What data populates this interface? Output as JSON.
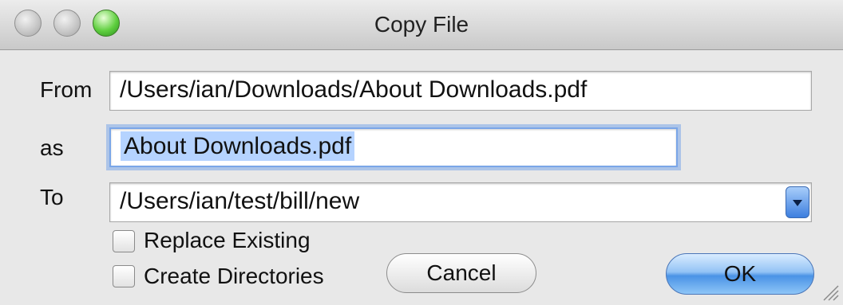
{
  "window": {
    "title": "Copy File"
  },
  "form": {
    "from_label": "From",
    "from_value": "/Users/ian/Downloads/About Downloads.pdf",
    "as_label": "as",
    "as_value": "About Downloads.pdf",
    "to_label": "To",
    "to_value": "/Users/ian/test/bill/new"
  },
  "options": {
    "replace_existing": {
      "label": "Replace Existing",
      "checked": false
    },
    "create_directories": {
      "label": "Create Directories",
      "checked": false
    }
  },
  "buttons": {
    "cancel": "Cancel",
    "ok": "OK"
  },
  "icons": {
    "close": "close-icon",
    "minimize": "minimize-icon",
    "zoom": "zoom-icon",
    "dropdown": "chevron-down-icon",
    "resize": "resize-grip-icon"
  },
  "colors": {
    "focus_ring": "#7aa6e8",
    "selection": "#b5d3ff",
    "default_button": "#4a93e6",
    "zoom_green": "#5fcf3f"
  }
}
